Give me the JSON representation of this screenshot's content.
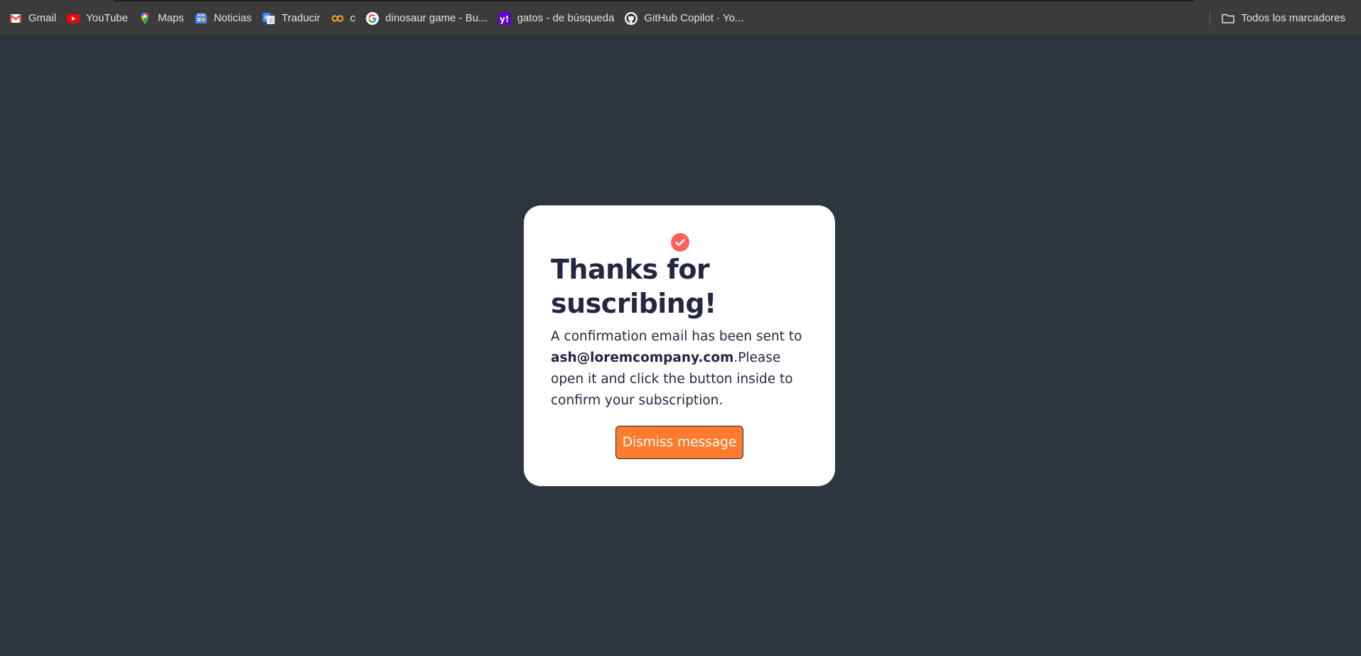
{
  "bookmarks": [
    {
      "label": "Gmail",
      "icon": "gmail-icon"
    },
    {
      "label": "YouTube",
      "icon": "youtube-icon"
    },
    {
      "label": "Maps",
      "icon": "maps-icon"
    },
    {
      "label": "Noticias",
      "icon": "news-icon"
    },
    {
      "label": "Traducir",
      "icon": "translate-icon"
    },
    {
      "label": "c",
      "icon": "infinity-icon"
    },
    {
      "label": "dinosaur game - Bu...",
      "icon": "google-icon"
    },
    {
      "label": "gatos - de búsqueda",
      "icon": "yahoo-icon"
    },
    {
      "label": "GitHub Copilot · Yo...",
      "icon": "github-icon"
    }
  ],
  "all_bookmarks": {
    "label": "Todos los marcadores",
    "icon": "folder-icon"
  },
  "card": {
    "title": "Thanks for suscribing!",
    "message_prefix": "A confirmation email has been sent to ",
    "email": "ash@loremcompany.com",
    "message_suffix": ".Please open it and click the button inside to confirm your subscription.",
    "dismiss_label": "Dismiss message"
  },
  "colors": {
    "page_background": "#2d363e",
    "card_background": "#ffffff",
    "accent_check": "#ff6155",
    "button": "#fd7b2c",
    "text": "#242742"
  }
}
